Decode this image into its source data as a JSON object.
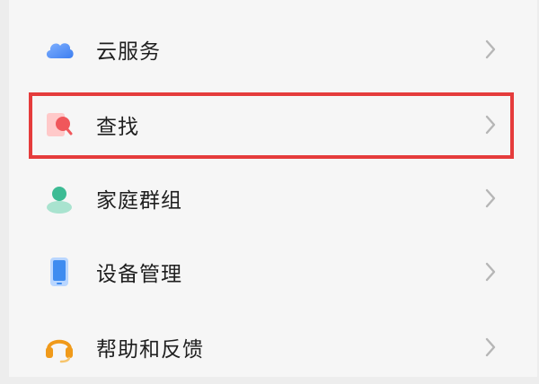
{
  "menu": {
    "items": [
      {
        "label": "云服务",
        "icon": "cloud-icon",
        "color": "#4f8ff5"
      },
      {
        "label": "查找",
        "icon": "find-search-icon",
        "color": "#f0575b"
      },
      {
        "label": "家庭群组",
        "icon": "family-group-icon",
        "color": "#3dbb94"
      },
      {
        "label": "设备管理",
        "icon": "phone-device-icon",
        "color": "#3f8cf0"
      },
      {
        "label": "帮助和反馈",
        "icon": "headset-help-icon",
        "color": "#f09a1a"
      }
    ],
    "highlighted_item": "查找"
  },
  "colors": {
    "highlight_border": "#e53c3c",
    "chevron": "#b6b6b6",
    "text": "#1f1f1f"
  }
}
